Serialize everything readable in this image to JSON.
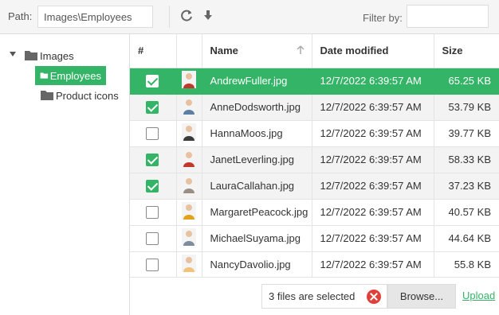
{
  "toolbar": {
    "path_label": "Path:",
    "path_value": "Images\\Employees",
    "refresh_icon": "refresh-icon",
    "download_icon": "download-icon",
    "filter_label": "Filter by:",
    "filter_value": ""
  },
  "tree": {
    "root": "Images",
    "children": [
      "Employees",
      "Product icons"
    ],
    "selected": "Employees"
  },
  "grid": {
    "columns": [
      "#",
      "",
      "Name",
      "Date modified",
      "Size"
    ],
    "sort": {
      "column": "Name",
      "direction": "ascending"
    },
    "rows": [
      {
        "checked": true,
        "name": "AndrewFuller.jpg",
        "date": "12/7/2022 6:39:57 AM",
        "size": "65.25 KB",
        "selected": true,
        "alt": false
      },
      {
        "checked": true,
        "name": "AnneDodsworth.jpg",
        "date": "12/7/2022 6:39:57 AM",
        "size": "53.79 KB",
        "selected": false,
        "alt": true
      },
      {
        "checked": false,
        "name": "HannaMoos.jpg",
        "date": "12/7/2022 6:39:57 AM",
        "size": "39.77 KB",
        "selected": false,
        "alt": false
      },
      {
        "checked": true,
        "name": "JanetLeverling.jpg",
        "date": "12/7/2022 6:39:57 AM",
        "size": "58.33 KB",
        "selected": false,
        "alt": true
      },
      {
        "checked": true,
        "name": "LauraCallahan.jpg",
        "date": "12/7/2022 6:39:57 AM",
        "size": "37.23 KB",
        "selected": false,
        "alt": true
      },
      {
        "checked": false,
        "name": "MargaretPeacock.jpg",
        "date": "12/7/2022 6:39:57 AM",
        "size": "40.57 KB",
        "selected": false,
        "alt": false
      },
      {
        "checked": false,
        "name": "MichaelSuyama.jpg",
        "date": "12/7/2022 6:39:57 AM",
        "size": "44.64 KB",
        "selected": false,
        "alt": false
      },
      {
        "checked": false,
        "name": "NancyDavolio.jpg",
        "date": "12/7/2022 6:39:57 AM",
        "size": "55.8 KB",
        "selected": false,
        "alt": false
      }
    ]
  },
  "footer": {
    "status": "3 files are selected",
    "browse_label": "Browse...",
    "upload_label": "Upload"
  },
  "colors": {
    "accent": "#34b467",
    "clear": "#e0403a",
    "thumb_colors": [
      "#c0392b",
      "#5d7fa3",
      "#3b3b3b",
      "#c0392b",
      "#9a8f86",
      "#e3a11d",
      "#7f8c9d",
      "#f0c27b"
    ]
  }
}
